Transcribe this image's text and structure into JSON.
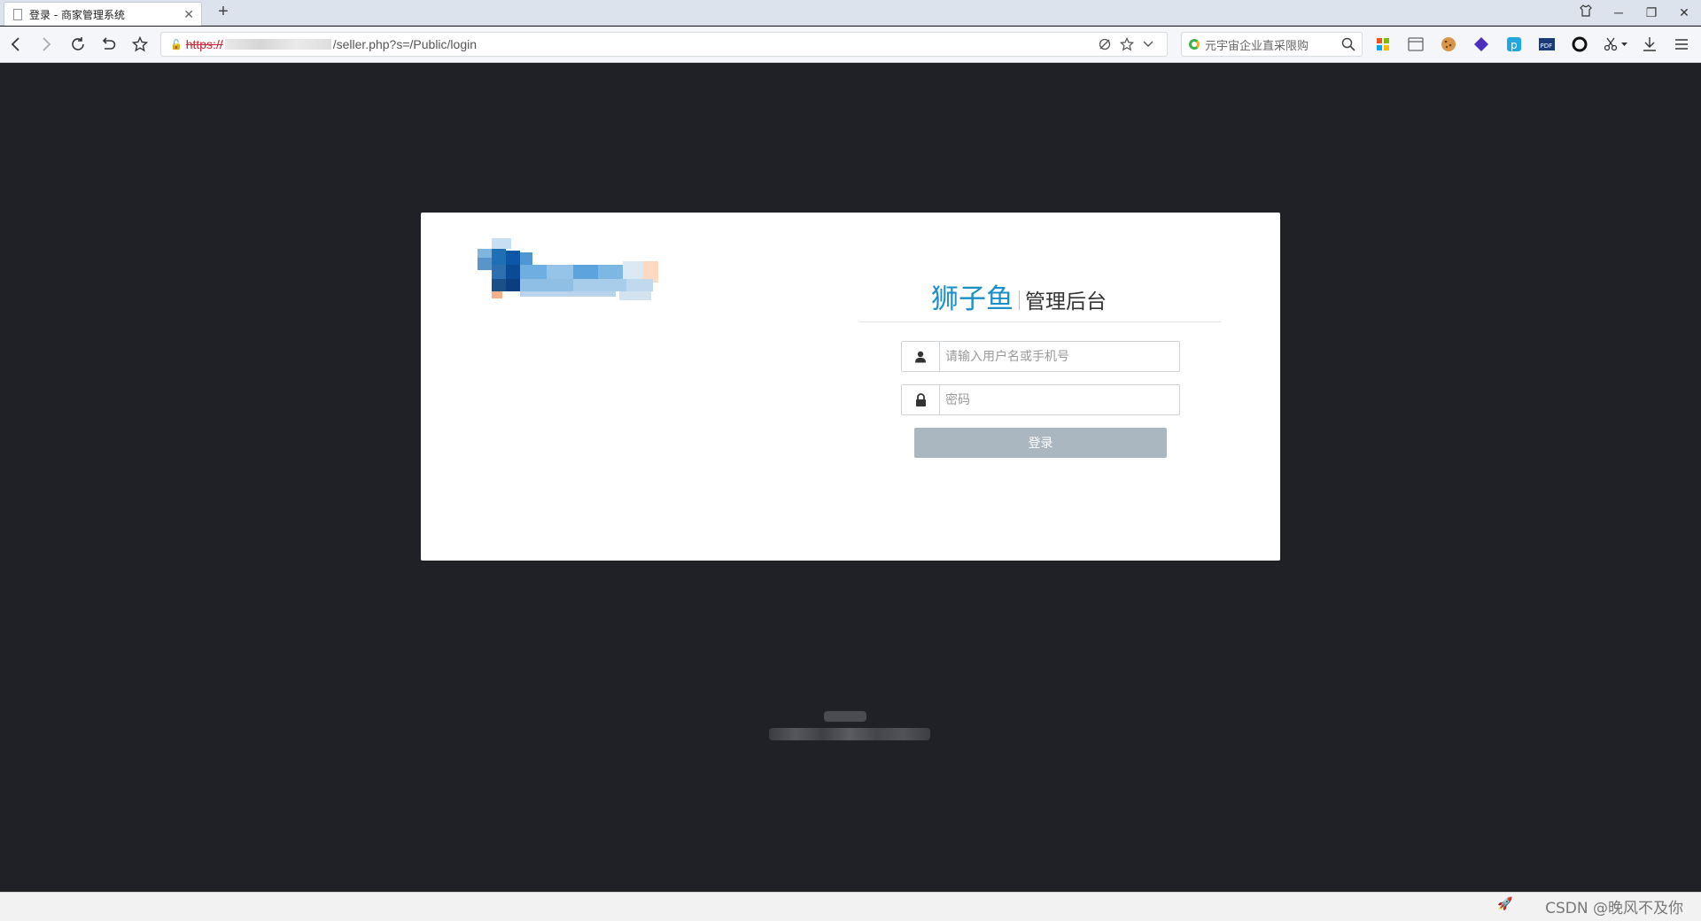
{
  "browser": {
    "tab_title": "登录 - 商家管理系统",
    "url_protocol": "https://",
    "url_path": "/seller.php?s=/Public/login",
    "search_placeholder": "元宇宙企业直采限购"
  },
  "login": {
    "brand_name": "狮子鱼",
    "brand_subtitle": "管理后台",
    "username_placeholder": "请输入用户名或手机号",
    "password_placeholder": "密码",
    "submit_label": "登录"
  },
  "watermark": "CSDN @晚风不及你",
  "colors": {
    "page_bg": "#1f2126",
    "brand_blue": "#1a8fc9",
    "button_bg": "#aab6c0"
  },
  "icons": {
    "username": "user-icon",
    "password": "lock-icon"
  }
}
